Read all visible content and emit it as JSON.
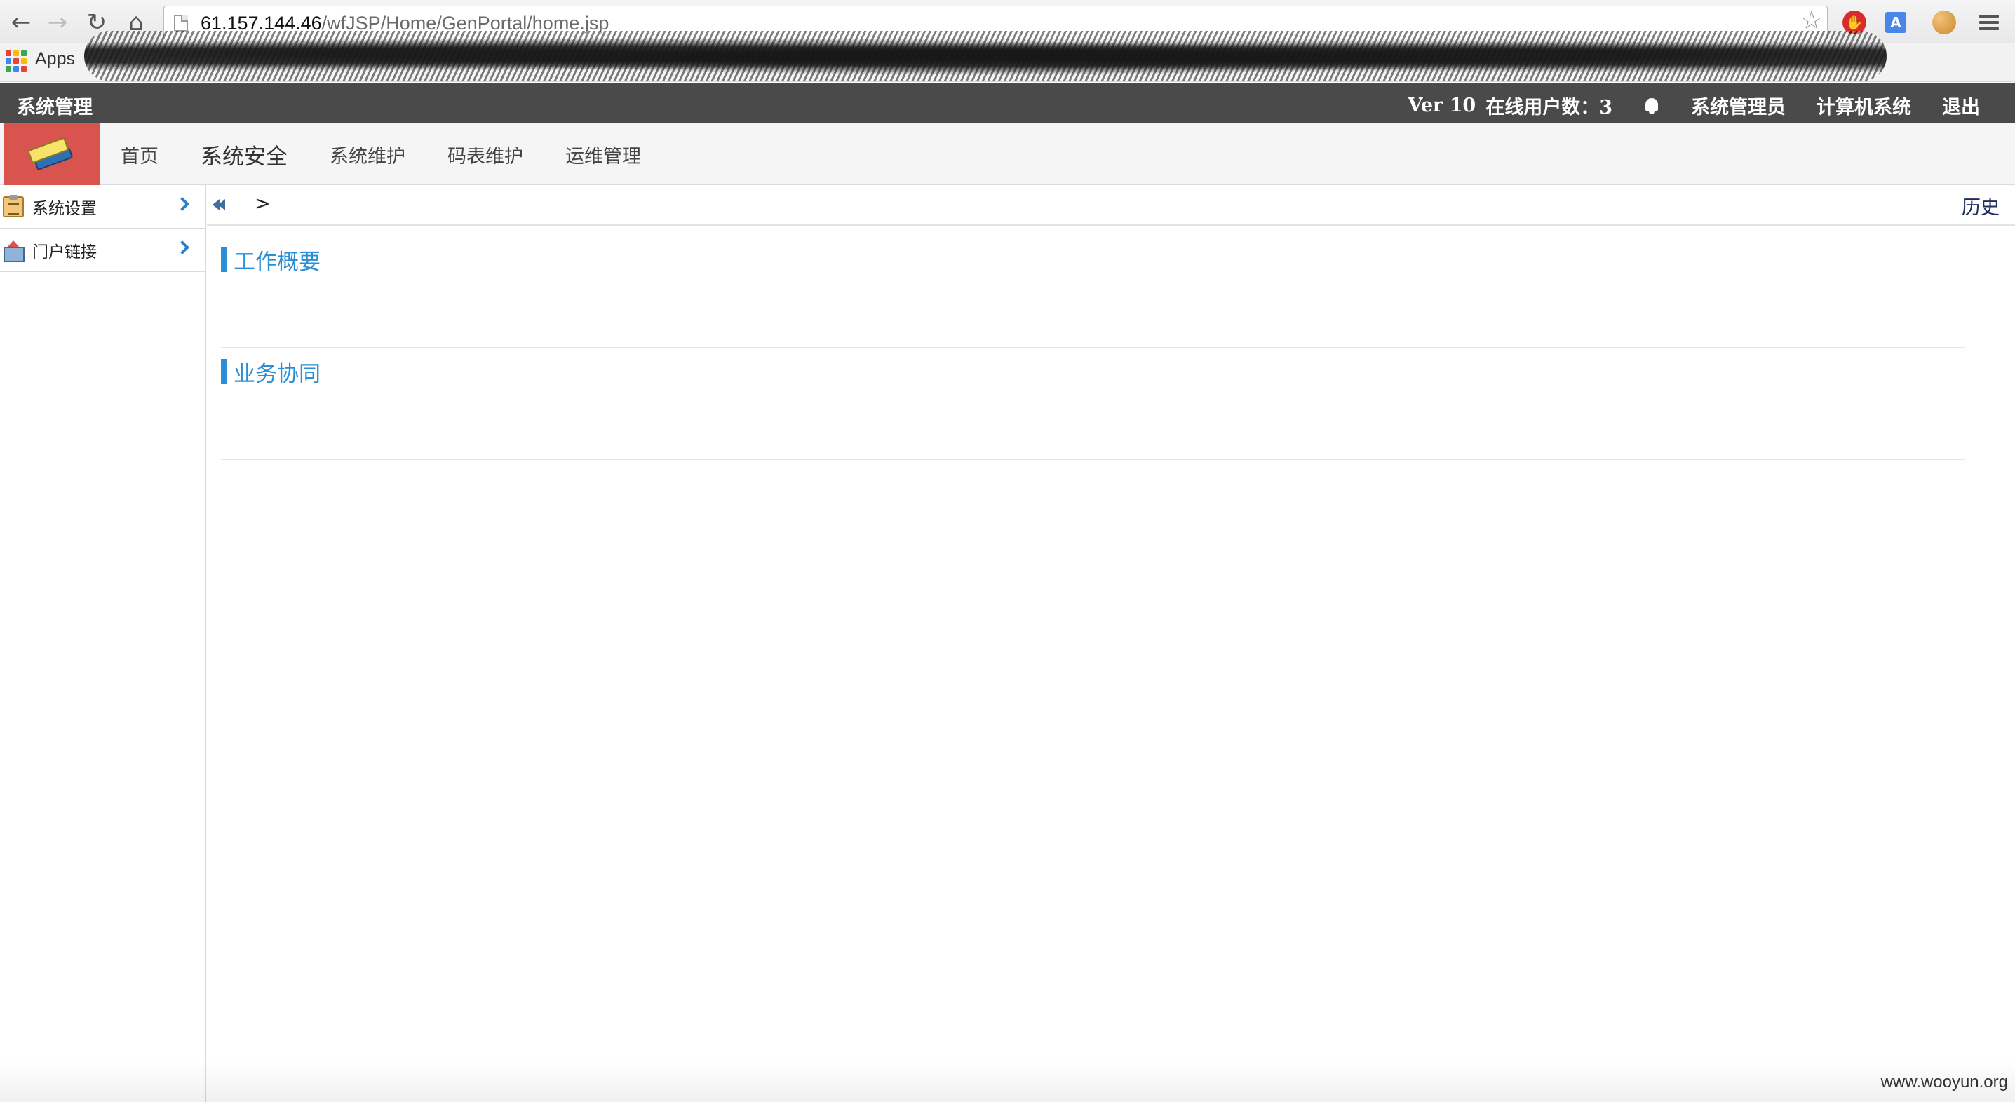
{
  "browser": {
    "url_host": "61.157.144.46",
    "url_path": "/wfJSP/Home/GenPortal/home.jsp",
    "bookmarks_apps_label": "Apps"
  },
  "app_bar": {
    "system_title": "系统管理",
    "version": "Ver 10",
    "online_users_label": "在线用户数：3",
    "user_name": "系统管理员",
    "department": "计算机系统",
    "logout": "退出"
  },
  "menu": {
    "items": [
      {
        "label": "首页",
        "active": false
      },
      {
        "label": "系统安全",
        "active": true
      },
      {
        "label": "系统维护",
        "active": false
      },
      {
        "label": "码表维护",
        "active": false
      },
      {
        "label": "运维管理",
        "active": false
      }
    ]
  },
  "sidebar": {
    "items": [
      {
        "label": "系统设置",
        "icon": "clipboard-icon"
      },
      {
        "label": "门户链接",
        "icon": "house-icon"
      }
    ]
  },
  "breadcrumb": {
    "separator": ">",
    "history_label": "历史"
  },
  "sections": [
    {
      "title": "工作概要"
    },
    {
      "title": "业务协同"
    }
  ],
  "watermark": "www.wooyun.org",
  "colors": {
    "app_bar_bg": "#4a4a4a",
    "logo_bg": "#d9534f",
    "accent_blue": "#2b8fd8"
  }
}
